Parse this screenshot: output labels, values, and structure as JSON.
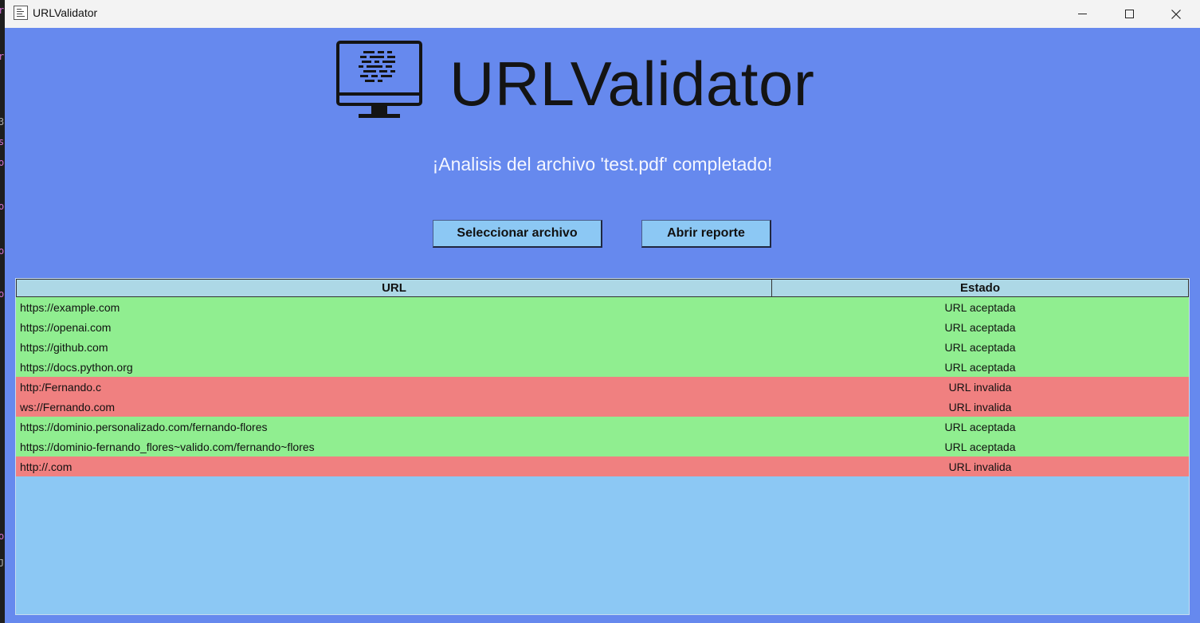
{
  "window": {
    "title": "URLValidator"
  },
  "logo": {
    "text": "URLValidator",
    "icon": "monitor-code-icon"
  },
  "status_message": "¡Analisis del archivo 'test.pdf' completado!",
  "buttons": {
    "select_file": "Seleccionar archivo",
    "open_report": "Abrir reporte"
  },
  "table": {
    "columns": [
      "URL",
      "Estado"
    ],
    "rows": [
      {
        "url": "https://example.com",
        "estado": "URL aceptada",
        "valid": true
      },
      {
        "url": "https://openai.com",
        "estado": "URL aceptada",
        "valid": true
      },
      {
        "url": "https://github.com",
        "estado": "URL aceptada",
        "valid": true
      },
      {
        "url": "https://docs.python.org",
        "estado": "URL aceptada",
        "valid": true
      },
      {
        "url": "http:/Fernando.c",
        "estado": "URL invalida",
        "valid": false
      },
      {
        "url": "ws://Fernando.com",
        "estado": "URL invalida",
        "valid": false
      },
      {
        "url": "https://dominio.personalizado.com/fernando-flores",
        "estado": "URL aceptada",
        "valid": true
      },
      {
        "url": "https://dominio-fernando_flores~valido.com/fernando~flores",
        "estado": "URL aceptada",
        "valid": true
      },
      {
        "url": "http://.com",
        "estado": "URL invalida",
        "valid": false
      }
    ]
  },
  "colors": {
    "background": "#6689ee",
    "button": "#8cc8f4",
    "header": "#add8e6",
    "accepted_row": "#90ee90",
    "invalid_row": "#f08080",
    "table_empty": "#8cc8f4"
  }
}
